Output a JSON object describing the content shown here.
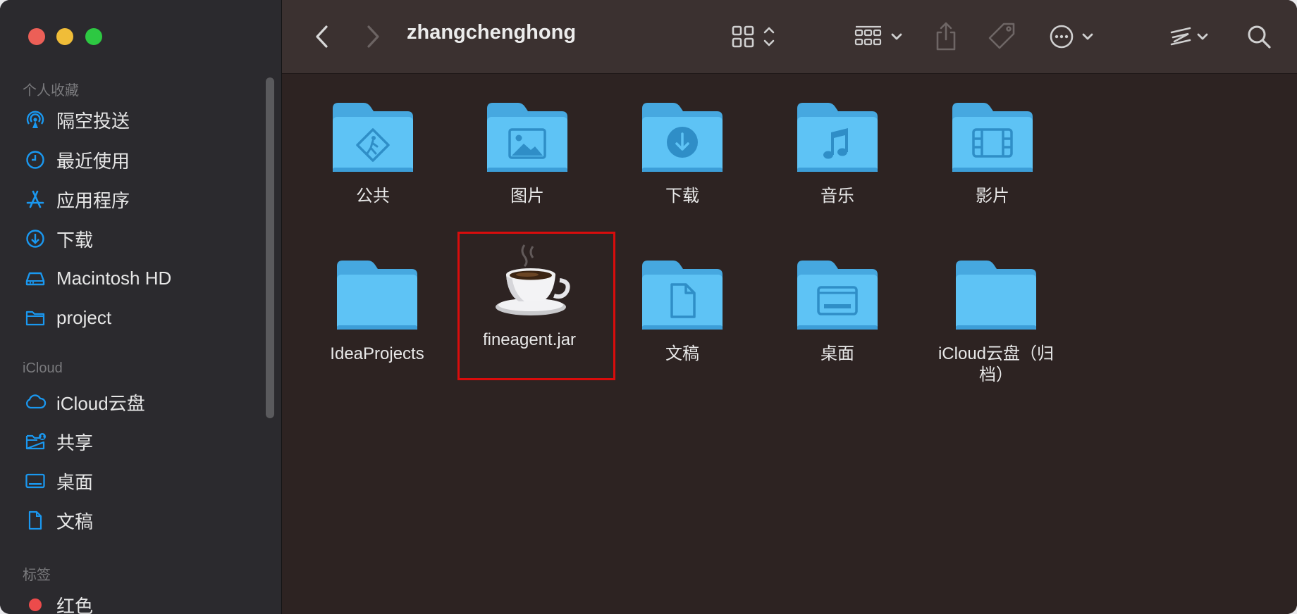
{
  "window": {
    "title": "zhangchenghong"
  },
  "sidebar": {
    "favorites_header": "个人收藏",
    "favorites": [
      {
        "label": "隔空投送",
        "icon": "airdrop-icon"
      },
      {
        "label": "最近使用",
        "icon": "clock-icon"
      },
      {
        "label": "应用程序",
        "icon": "applications-icon"
      },
      {
        "label": "下载",
        "icon": "download-icon"
      },
      {
        "label": "Macintosh HD",
        "icon": "disk-icon"
      },
      {
        "label": "project",
        "icon": "folder-icon"
      }
    ],
    "icloud_header": "iCloud",
    "icloud": [
      {
        "label": "iCloud云盘",
        "icon": "cloud-icon"
      },
      {
        "label": "共享",
        "icon": "shared-folder-icon"
      },
      {
        "label": "桌面",
        "icon": "desktop-icon"
      },
      {
        "label": "文稿",
        "icon": "document-icon"
      }
    ],
    "tags_header": "标签",
    "tags": [
      {
        "label": "红色",
        "color": "#ec4b4b"
      }
    ]
  },
  "files": [
    {
      "name": "公共",
      "kind": "folder",
      "badge": "public-icon"
    },
    {
      "name": "图片",
      "kind": "folder",
      "badge": "picture-icon"
    },
    {
      "name": "下载",
      "kind": "folder",
      "badge": "download-icon"
    },
    {
      "name": "音乐",
      "kind": "folder",
      "badge": "music-icon"
    },
    {
      "name": "影片",
      "kind": "folder",
      "badge": "film-icon"
    },
    {
      "name": "IdeaProjects",
      "kind": "folder",
      "badge": ""
    },
    {
      "name": "fineagent.jar",
      "kind": "jar",
      "badge": "java-coffee-icon",
      "highlighted": true
    },
    {
      "name": "文稿",
      "kind": "folder",
      "badge": "document-icon"
    },
    {
      "name": "桌面",
      "kind": "folder",
      "badge": "desktop-icon"
    },
    {
      "name": "iCloud云盘（归档）",
      "kind": "folder",
      "badge": ""
    }
  ],
  "colors": {
    "folder": "#5ec3f5",
    "folder_tab": "#46a8e0",
    "sidebar_icon": "#1a98f0",
    "selection_outline": "#d90c0c"
  }
}
